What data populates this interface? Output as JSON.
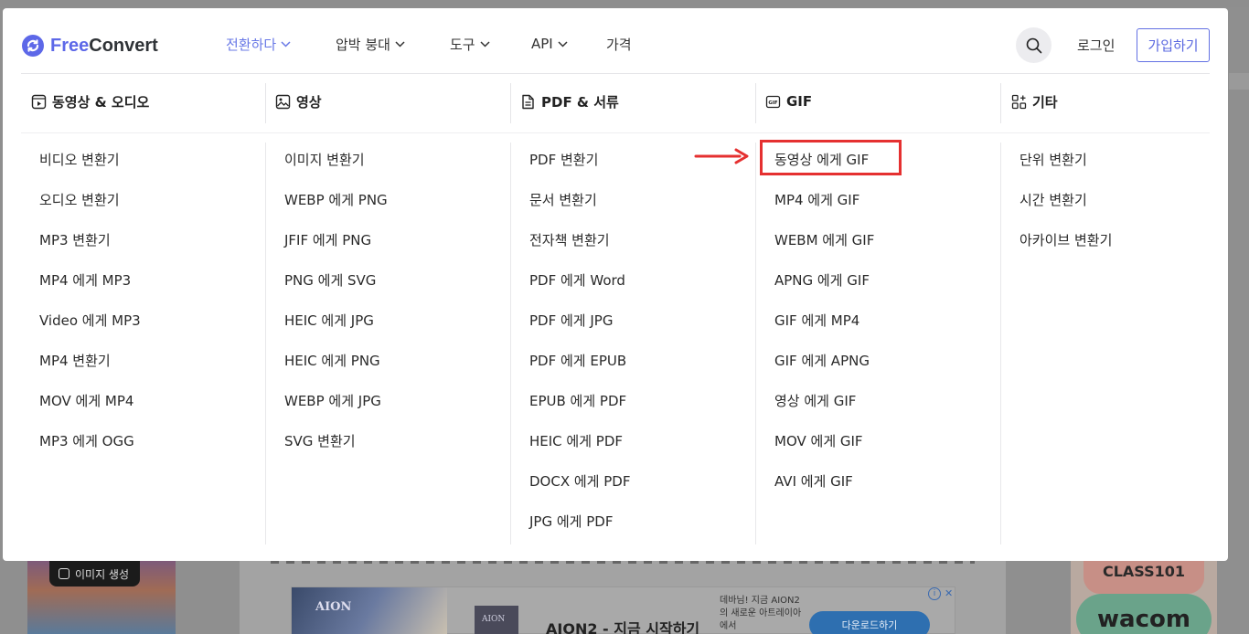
{
  "brand": {
    "free": "Free",
    "convert": "Convert",
    "color_free": "#5d68e8",
    "color_convert": "#2f3337"
  },
  "nav": [
    {
      "label": "전환하다",
      "active": true
    },
    {
      "label": "압박 붕대",
      "active": false
    },
    {
      "label": "도구",
      "active": false
    },
    {
      "label": "API",
      "active": false
    },
    {
      "label": "가격",
      "active": false
    }
  ],
  "header": {
    "login": "로그인",
    "signup": "가입하기",
    "search_icon": "search-icon"
  },
  "categories": [
    {
      "title": "동영상 & 오디오",
      "icon": "video-icon",
      "items": [
        "비디오 변환기",
        "오디오 변환기",
        "MP3 변환기",
        "MP4 에게 MP3",
        "Video 에게 MP3",
        "MP4 변환기",
        "MOV 에게 MP4",
        "MP3 에게 OGG"
      ]
    },
    {
      "title": "영상",
      "icon": "image-icon",
      "items": [
        "이미지 변환기",
        "WEBP 에게 PNG",
        "JFIF 에게 PNG",
        "PNG 에게 SVG",
        "HEIC 에게 JPG",
        "HEIC 에게 PNG",
        "WEBP 에게 JPG",
        "SVG 변환기"
      ]
    },
    {
      "title": "PDF & 서류",
      "icon": "document-icon",
      "items": [
        "PDF 변환기",
        "문서 변환기",
        "전자책 변환기",
        "PDF 에게 Word",
        "PDF 에게 JPG",
        "PDF 에게 EPUB",
        "EPUB 에게 PDF",
        "HEIC 에게 PDF",
        "DOCX 에게 PDF",
        "JPG 에게 PDF"
      ]
    },
    {
      "title": "GIF",
      "icon": "gif-icon",
      "items": [
        "동영상 에게 GIF",
        "MP4 에게 GIF",
        "WEBM 에게 GIF",
        "APNG 에게 GIF",
        "GIF 에게 MP4",
        "GIF 에게 APNG",
        "영상 에게 GIF",
        "MOV 에게 GIF",
        "AVI 에게 GIF"
      ]
    },
    {
      "title": "기타",
      "icon": "grid-icon",
      "items": [
        "단위 변환기",
        "시간 변환기",
        "아카이브 변환기"
      ]
    }
  ],
  "annotation": {
    "highlight_color": "#e53030"
  },
  "background": {
    "ad_left_pill": "이미지 생성",
    "banner_logo": "AION",
    "banner_thumb": "AION",
    "banner_headline": "AION2 - 지금 시작하기",
    "banner_small": "데바님! 지금 AION2의 새로운 아트레이아에서",
    "banner_button": "다운로드하기",
    "ad_right_top": "CLASS101",
    "ad_right_brand": "wacom"
  }
}
